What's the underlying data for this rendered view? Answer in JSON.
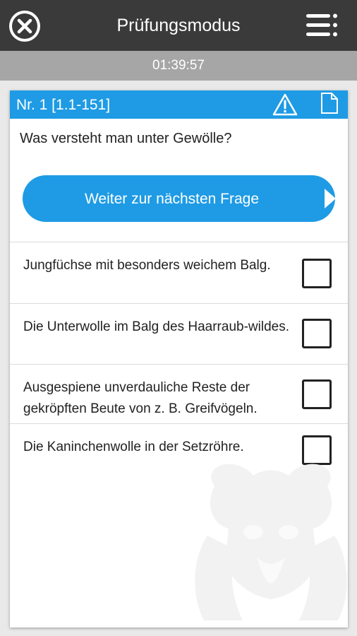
{
  "header": {
    "title": "Prüfungsmodus",
    "close_icon": "close-icon",
    "menu_icon": "menu-list-icon"
  },
  "timer": {
    "value": "01:39:57"
  },
  "card": {
    "question_number": "Nr. 1 [1.1-151]",
    "warning_icon": "warning-icon",
    "note_icon": "note-icon",
    "question": "Was versteht man unter Gewölle?",
    "next_button": "Weiter zur nächsten Frage",
    "answers": [
      {
        "text": "Jungfüchse mit besonders weichem Balg.",
        "checked": false
      },
      {
        "text": "Die Unterwolle im Balg des Haarraub-wildes.",
        "checked": false
      },
      {
        "text": "Ausgespiene unverdauliche Reste der gekröpften Beute von z. B. Greifvögeln.",
        "checked": false
      },
      {
        "text": "Die Kaninchenwolle in der Setzröhre.",
        "checked": false
      }
    ]
  },
  "colors": {
    "accent": "#1e9be4",
    "topbar": "#3a3a3a",
    "timerbar": "#a6a6a6"
  }
}
